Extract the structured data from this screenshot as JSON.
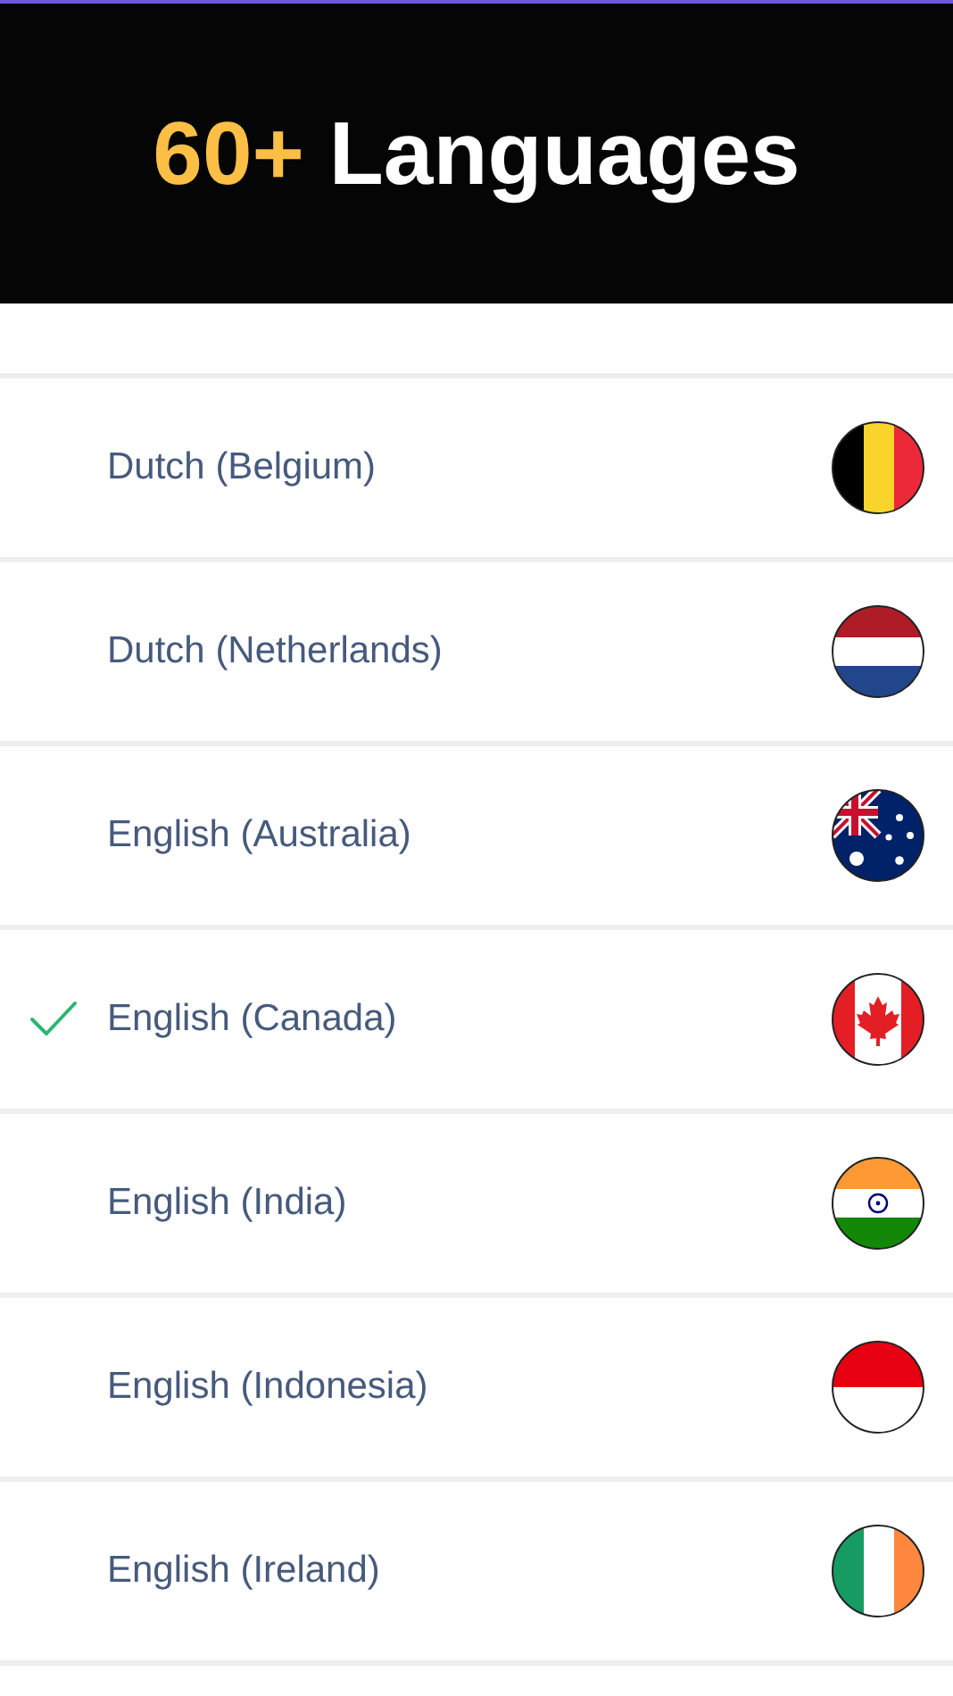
{
  "banner": {
    "highlight": "60+",
    "title": "Languages"
  },
  "languages": [
    {
      "name": "Dutch (Belgium)",
      "kind": "be",
      "selected": false
    },
    {
      "name": "Dutch (Netherlands)",
      "kind": "nl",
      "selected": false
    },
    {
      "name": "English (Australia)",
      "kind": "au",
      "selected": false
    },
    {
      "name": "English (Canada)",
      "kind": "ca",
      "selected": true
    },
    {
      "name": "English (India)",
      "kind": "in",
      "selected": false
    },
    {
      "name": "English (Indonesia)",
      "kind": "id",
      "selected": false
    },
    {
      "name": "English (Ireland)",
      "kind": "ie",
      "selected": false
    }
  ]
}
